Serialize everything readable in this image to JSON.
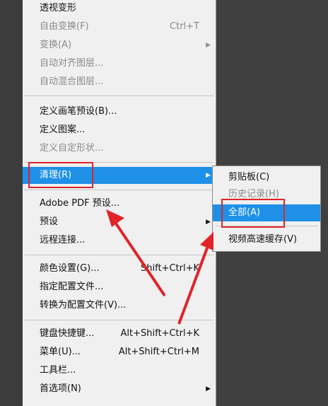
{
  "menu": {
    "items": [
      {
        "label": "透视变形",
        "shortcut": "",
        "disabled": false
      },
      {
        "label": "自由变换(F)",
        "shortcut": "Ctrl+T",
        "disabled": true
      },
      {
        "label": "变换(A)",
        "shortcut": "",
        "disabled": true,
        "submenu": true
      },
      {
        "label": "自动对齐图层...",
        "shortcut": "",
        "disabled": true
      },
      {
        "label": "自动混合图层...",
        "shortcut": "",
        "disabled": true
      },
      {
        "label": "定义画笔预设(B)...",
        "shortcut": "",
        "disabled": false
      },
      {
        "label": "定义图案...",
        "shortcut": "",
        "disabled": false
      },
      {
        "label": "定义自定形状...",
        "shortcut": "",
        "disabled": true
      },
      {
        "label": "清理(R)",
        "shortcut": "",
        "disabled": false,
        "submenu": true,
        "highlighted": true
      },
      {
        "label": "Adobe PDF 预设...",
        "shortcut": "",
        "disabled": false
      },
      {
        "label": "预设",
        "shortcut": "",
        "disabled": false,
        "submenu": true
      },
      {
        "label": "远程连接...",
        "shortcut": "",
        "disabled": false
      },
      {
        "label": "颜色设置(G)...",
        "shortcut": "Shift+Ctrl+K",
        "disabled": false
      },
      {
        "label": "指定配置文件...",
        "shortcut": "",
        "disabled": false
      },
      {
        "label": "转换为配置文件(V)...",
        "shortcut": "",
        "disabled": false
      },
      {
        "label": "键盘快捷键...",
        "shortcut": "Alt+Shift+Ctrl+K",
        "disabled": false
      },
      {
        "label": "菜单(U)...",
        "shortcut": "Alt+Shift+Ctrl+M",
        "disabled": false
      },
      {
        "label": "工具栏...",
        "shortcut": "",
        "disabled": false
      },
      {
        "label": "首选项(N)",
        "shortcut": "",
        "disabled": false,
        "submenu": true
      }
    ]
  },
  "submenu": {
    "items": [
      {
        "label": "剪贴板(C)",
        "disabled": false
      },
      {
        "label": "历史记录(H)",
        "disabled": true
      },
      {
        "label": "全部(A)",
        "disabled": false,
        "highlighted": true
      },
      {
        "label": "视频高速缓存(V)",
        "disabled": false
      }
    ]
  },
  "icons": {
    "submenu_arrow": "▶"
  },
  "colors": {
    "highlight": "#1e90e8",
    "annotation": "#e0242a",
    "menu_bg": "#f0f0f0"
  }
}
